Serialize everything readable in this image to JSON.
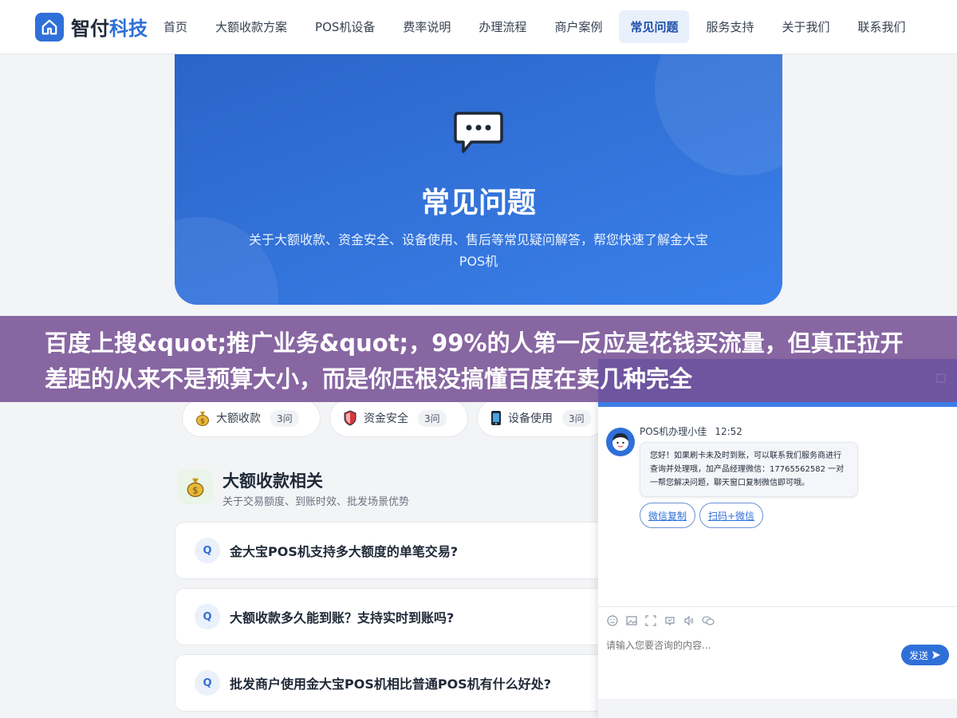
{
  "header": {
    "logo_part1": "智付",
    "logo_part2": "科技",
    "nav": [
      {
        "label": "首页"
      },
      {
        "label": "大额收款方案"
      },
      {
        "label": "POS机设备"
      },
      {
        "label": "费率说明"
      },
      {
        "label": "办理流程"
      },
      {
        "label": "商户案例"
      },
      {
        "label": "常见问题",
        "active": true
      },
      {
        "label": "服务支持"
      },
      {
        "label": "关于我们"
      },
      {
        "label": "联系我们"
      }
    ]
  },
  "hero": {
    "title": "常见问题",
    "subtitle": "关于大额收款、资金安全、设备使用、售后等常见疑问解答，帮您快速了解金大宝POS机"
  },
  "banner": {
    "text": "百度上搜&quot;推广业务&quot;，99%的人第一反应是花钱买流量，但真正拉开差距的从来不是预算大小，而是你压根没搞懂百度在卖几种完全"
  },
  "categories": [
    {
      "label": "大额收款",
      "count": "3问",
      "icon": "money-bag-icon"
    },
    {
      "label": "资金安全",
      "count": "3问",
      "icon": "shield-icon"
    },
    {
      "label": "设备使用",
      "count": "3问",
      "icon": "phone-icon"
    }
  ],
  "section": {
    "title": "大额收款相关",
    "subtitle": "关于交易额度、到账时效、批发场景优势",
    "icon": "money-bag-icon"
  },
  "faqs": [
    {
      "q": "Q",
      "text": "金大宝POS机支持多大额度的单笔交易?"
    },
    {
      "q": "Q",
      "text": "大额收款多久能到账？支持实时到账吗?"
    },
    {
      "q": "Q",
      "text": "批发商户使用金大宝POS机相比普通POS机有什么好处?"
    }
  ],
  "chat": {
    "agent_name": "POS机办理小佳",
    "time": "12:52",
    "message": "您好！如果刷卡未及时到账，可以联系我们服务商进行查询并处理哦，加产品经理微信：17765562582 一对一帮您解决问题，聊天窗口复制微信即可哦。",
    "buttons": [
      "微信复制",
      "扫码+微信"
    ],
    "input_placeholder": "请输入您要咨询的内容...",
    "send_label": "发送",
    "colors": {
      "primary": "#2f6fd8"
    }
  }
}
